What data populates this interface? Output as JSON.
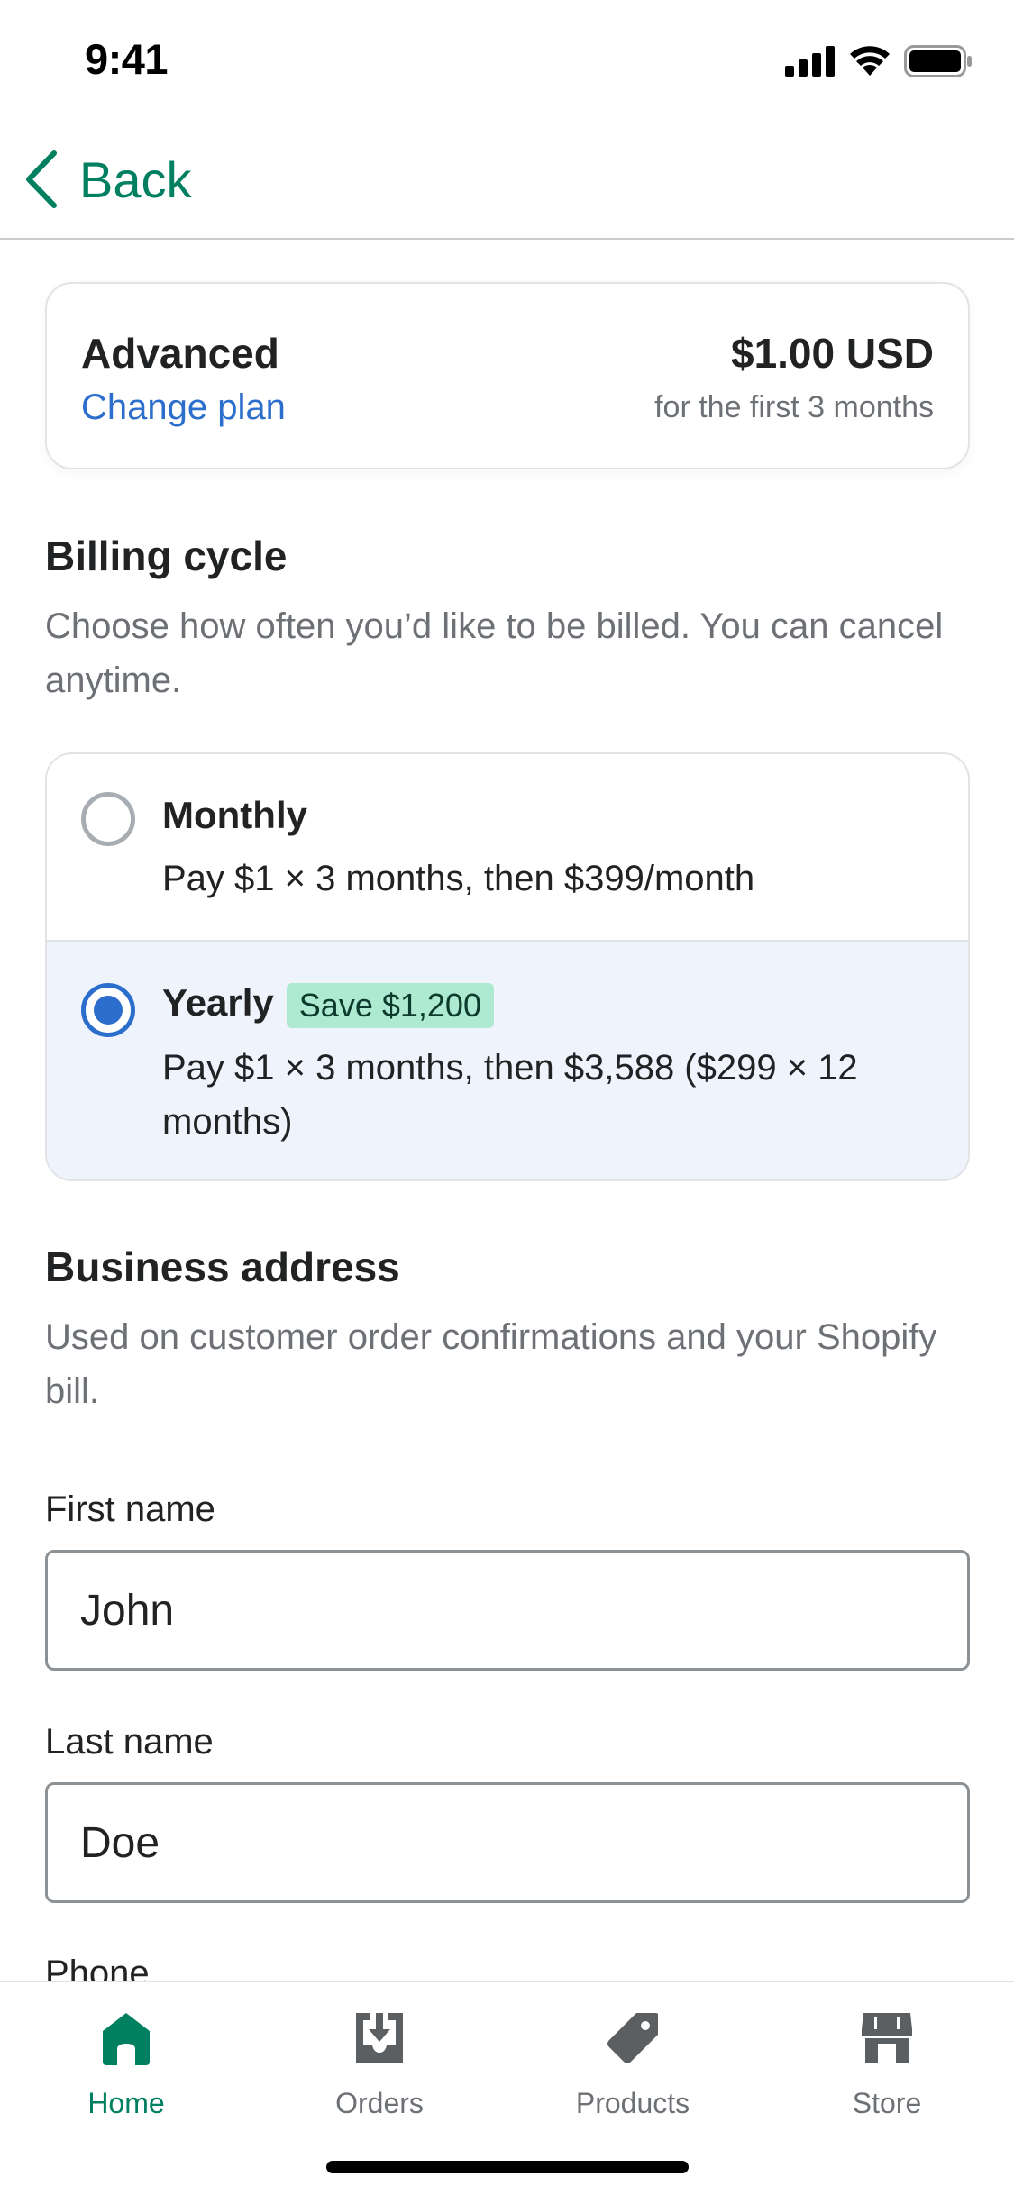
{
  "status_bar": {
    "time": "9:41"
  },
  "nav": {
    "back_label": "Back"
  },
  "plan": {
    "name": "Advanced",
    "change_label": "Change plan",
    "price": "$1.00 USD",
    "price_note": "for the first 3 months"
  },
  "billing": {
    "title": "Billing cycle",
    "description": "Choose how often you’d like to be billed. You can cancel anytime.",
    "options": [
      {
        "title": "Monthly",
        "description": "Pay $1 × 3 months, then $399/month",
        "selected": false
      },
      {
        "title": "Yearly",
        "badge": "Save $1,200",
        "description": "Pay $1 × 3 months, then $3,588 ($299 × 12 months)",
        "selected": true
      }
    ]
  },
  "address": {
    "title": "Business address",
    "description": "Used on customer order confirmations and your Shopify bill.",
    "fields": [
      {
        "label": "First name",
        "value": "John"
      },
      {
        "label": "Last name",
        "value": "Doe"
      },
      {
        "label": "Phone",
        "value": ""
      }
    ]
  },
  "tabs": [
    {
      "label": "Home",
      "icon": "home-icon",
      "active": true
    },
    {
      "label": "Orders",
      "icon": "orders-icon",
      "active": false
    },
    {
      "label": "Products",
      "icon": "tag-icon",
      "active": false
    },
    {
      "label": "Store",
      "icon": "store-icon",
      "active": false
    }
  ],
  "colors": {
    "accent": "#008060",
    "link": "#2c6ecb",
    "selected_bg": "#eef3fc",
    "badge_bg": "#aee9d1",
    "muted_text": "#6d7175"
  }
}
